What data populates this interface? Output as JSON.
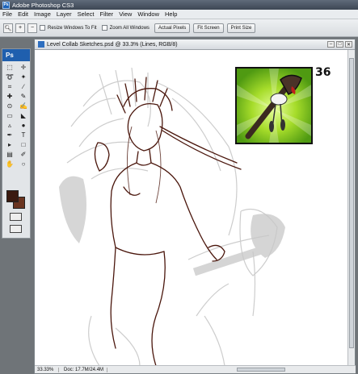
{
  "window": {
    "app_title": "Adobe Photoshop CS3",
    "app_badge": "Ps"
  },
  "menubar": {
    "items": [
      "File",
      "Edit",
      "Image",
      "Layer",
      "Select",
      "Filter",
      "View",
      "Window",
      "Help"
    ]
  },
  "options_bar": {
    "resize_label": "Resize Windows To Fit",
    "zoom_all_label": "Zoom All Windows",
    "actual_pixels": "Actual Pixels",
    "fit_screen": "Fit Screen",
    "print_size": "Print Size"
  },
  "toolbox": {
    "logo": "Ps"
  },
  "document": {
    "title": "Level Collab Sketches.psd @ 33.3% (Lines, RGB/8)",
    "badge_number": "36",
    "zoom": "33.33%",
    "doc_info": "Doc: 17.7M/24.4M"
  },
  "colors": {
    "foreground": "#3a1a10",
    "background": "#6a3420",
    "line_art": "#4a160c",
    "badge_green": "#7cc61c"
  }
}
